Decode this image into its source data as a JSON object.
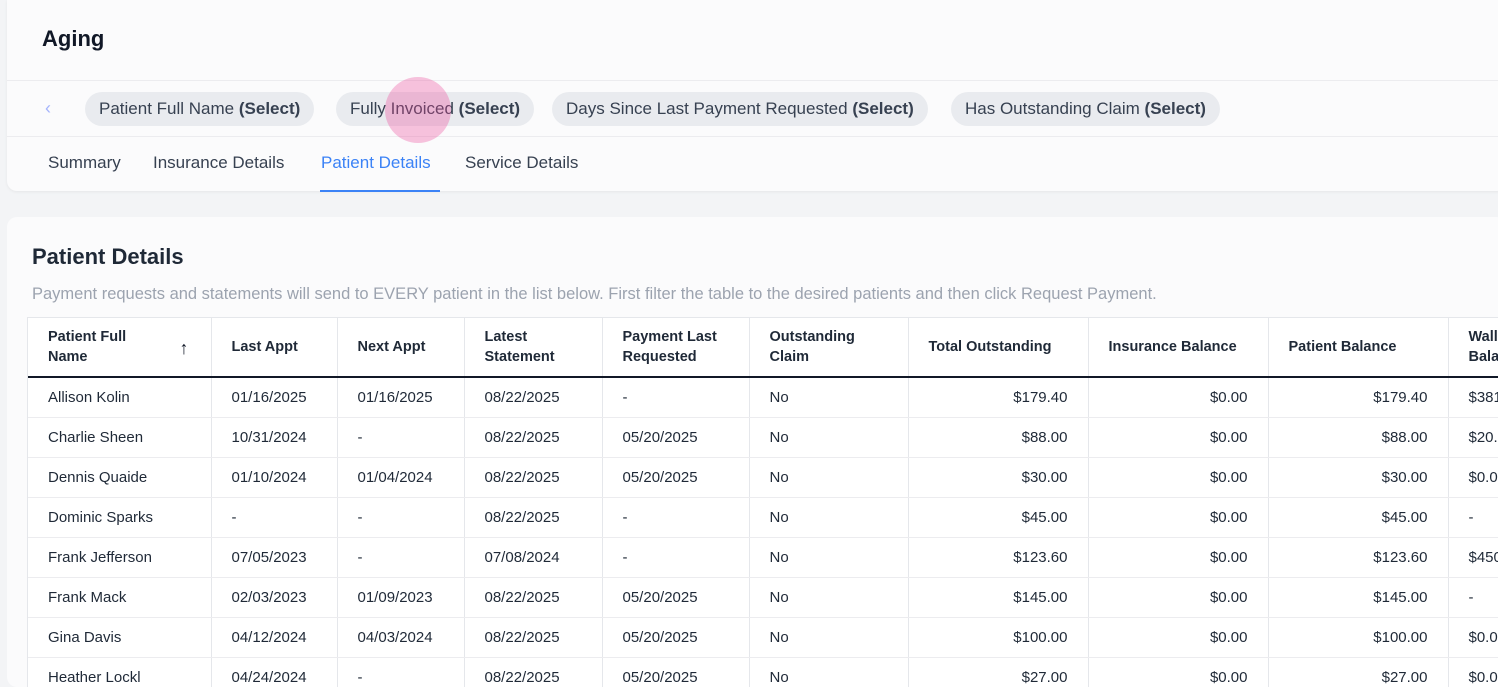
{
  "page": {
    "title": "Aging"
  },
  "filters": [
    {
      "name": "Patient Full Name",
      "value": "(Select)"
    },
    {
      "name": "Fully Invoiced",
      "value": "(Select)"
    },
    {
      "name": "Days Since Last Payment Requested",
      "value": "(Select)"
    },
    {
      "name": "Has Outstanding Claim",
      "value": "(Select)"
    }
  ],
  "tabs": [
    {
      "label": "Summary",
      "active": false
    },
    {
      "label": "Insurance Details",
      "active": false
    },
    {
      "label": "Patient Details",
      "active": true
    },
    {
      "label": "Service Details",
      "active": false
    }
  ],
  "section": {
    "title": "Patient Details",
    "description": "Payment requests and statements will send to EVERY patient in the list below. First filter the table to the desired patients and then click Request Payment."
  },
  "table": {
    "columns": [
      "Patient Full Name",
      "Last Appt",
      "Next Appt",
      "Latest Statement",
      "Payment Last Requested",
      "Outstanding Claim",
      "Total Outstanding",
      "Insurance Balance",
      "Patient Balance",
      "Wallet Balance"
    ],
    "rows": [
      [
        "Allison Kolin",
        "01/16/2025",
        "01/16/2025",
        "08/22/2025",
        "-",
        "No",
        "$179.40",
        "$0.00",
        "$179.40",
        "$381"
      ],
      [
        "Charlie Sheen",
        "10/31/2024",
        "-",
        "08/22/2025",
        "05/20/2025",
        "No",
        "$88.00",
        "$0.00",
        "$88.00",
        "$20."
      ],
      [
        "Dennis Quaide",
        "01/10/2024",
        "01/04/2024",
        "08/22/2025",
        "05/20/2025",
        "No",
        "$30.00",
        "$0.00",
        "$30.00",
        "$0.0"
      ],
      [
        "Dominic Sparks",
        "-",
        "-",
        "08/22/2025",
        "-",
        "No",
        "$45.00",
        "$0.00",
        "$45.00",
        "-"
      ],
      [
        "Frank Jefferson",
        "07/05/2023",
        "-",
        "07/08/2024",
        "-",
        "No",
        "$123.60",
        "$0.00",
        "$123.60",
        "$450"
      ],
      [
        "Frank Mack",
        "02/03/2023",
        "01/09/2023",
        "08/22/2025",
        "05/20/2025",
        "No",
        "$145.00",
        "$0.00",
        "$145.00",
        "-"
      ],
      [
        "Gina Davis",
        "04/12/2024",
        "04/03/2024",
        "08/22/2025",
        "05/20/2025",
        "No",
        "$100.00",
        "$0.00",
        "$100.00",
        "$0.0"
      ],
      [
        "Heather Lockl",
        "04/24/2024",
        "-",
        "08/22/2025",
        "05/20/2025",
        "No",
        "$27.00",
        "$0.00",
        "$27.00",
        "$0.0"
      ]
    ]
  },
  "icons": {
    "back": "chevron-left-icon",
    "sort": "arrow-up-icon"
  },
  "colors": {
    "accent": "#3b82f6",
    "touch": "#ec4899"
  }
}
